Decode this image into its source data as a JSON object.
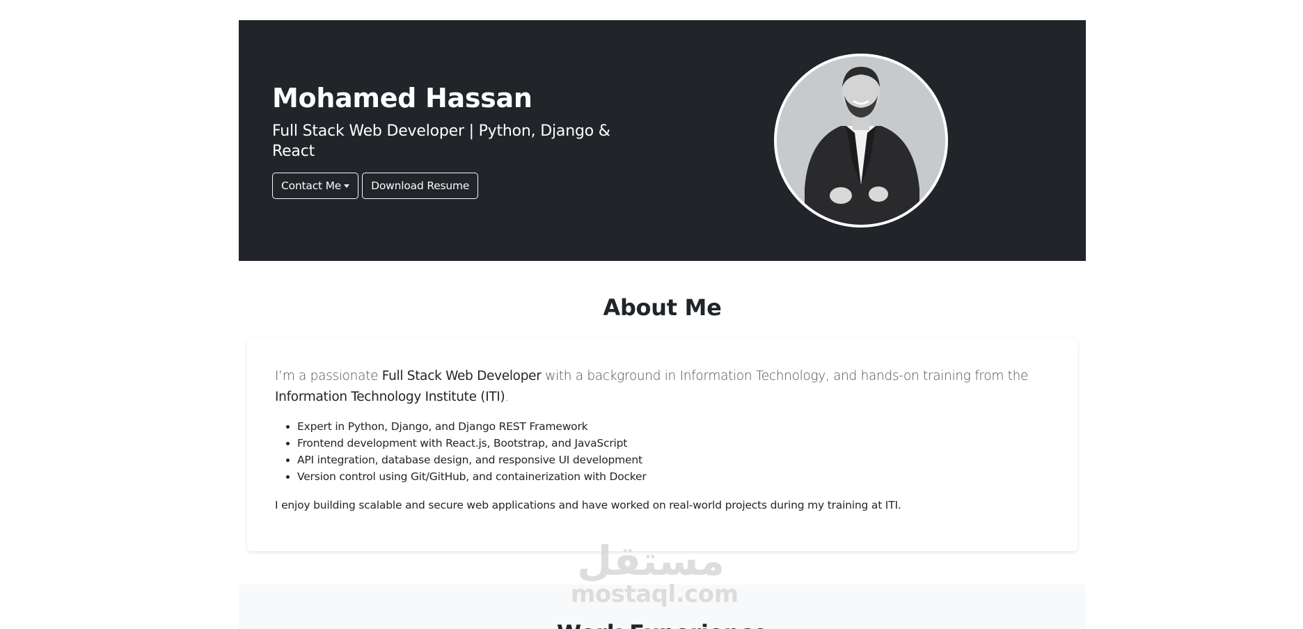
{
  "hero": {
    "name": "Mohamed Hassan",
    "subtitle": "Full Stack Web Developer | Python, Django & React",
    "contact_button": "Contact Me",
    "resume_button": "Download Resume",
    "avatar_icon": "profile-photo",
    "background_color": "#212529"
  },
  "about": {
    "title": "About Me",
    "lead_prefix": "I’m a passionate ",
    "lead_role": "Full Stack Web Developer",
    "lead_middle": " with a background in Information Technology, and hands-on training from the ",
    "lead_institute": "Information Technology Institute (ITI)",
    "lead_suffix": ".",
    "skills": [
      "Expert in Python, Django, and Django REST Framework",
      "Frontend development with React.js, Bootstrap, and JavaScript",
      "API integration, database design, and responsive UI development",
      "Version control using Git/GitHub, and containerization with Docker"
    ],
    "closing": "I enjoy building scalable and secure web applications and have worked on real-world projects during my training at ITI."
  },
  "work": {
    "title": "Work Experience"
  },
  "watermark": {
    "arabic": "مستقل",
    "latin": "mostaql.com"
  }
}
